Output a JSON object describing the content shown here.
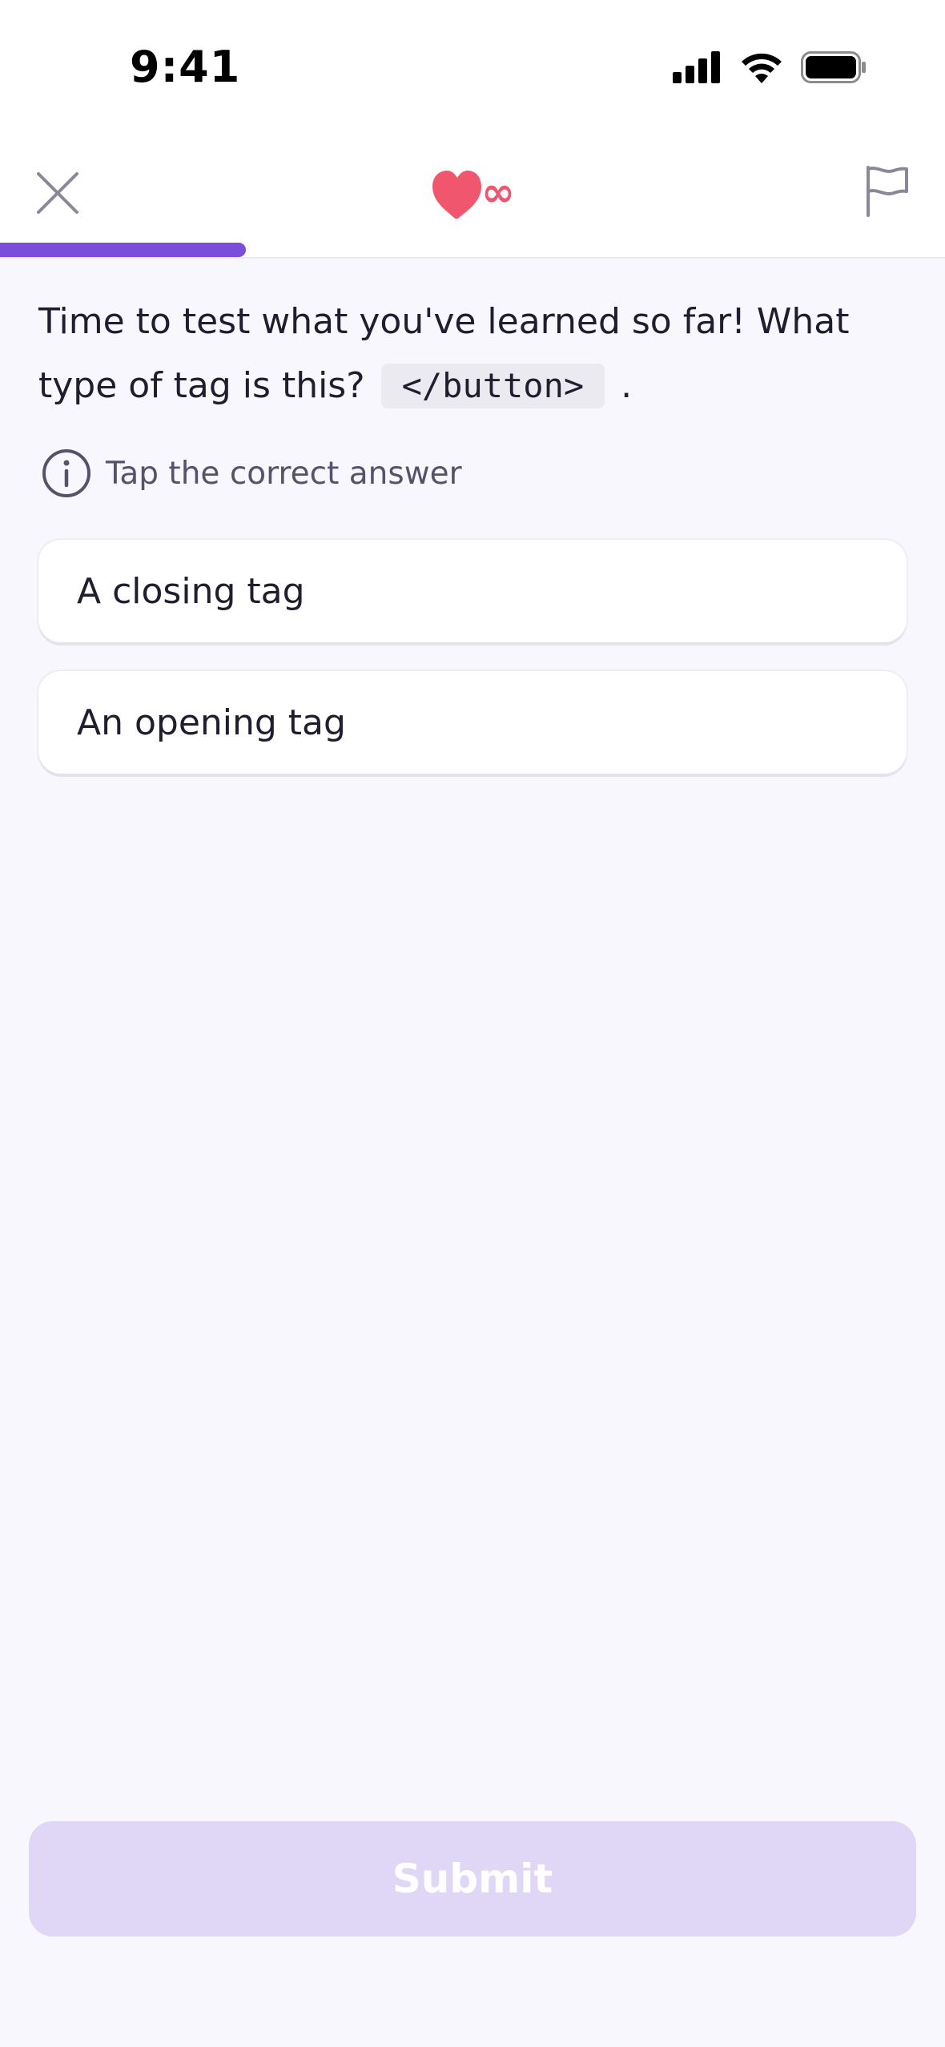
{
  "status_bar": {
    "time": "9:41",
    "icons": [
      "signal-icon",
      "wifi-icon",
      "battery-icon"
    ]
  },
  "header": {
    "close_icon": "close-icon",
    "lives_icon": "heart-icon",
    "lives_value": "∞",
    "flag_icon": "flag-icon",
    "progress_fraction": 0.26
  },
  "question": {
    "text_before": "Time to test what you've learned so far! What type of tag is this?",
    "code": "</button>",
    "text_after": "."
  },
  "hint": {
    "icon": "info-icon",
    "text": "Tap the correct answer"
  },
  "answers": [
    {
      "label": "A closing tag"
    },
    {
      "label": "An opening tag"
    }
  ],
  "submit": {
    "label": "Submit"
  },
  "colors": {
    "accent": "#7c4ddb",
    "heart": "#f0566e",
    "submit_disabled": "#e0d6f5"
  }
}
